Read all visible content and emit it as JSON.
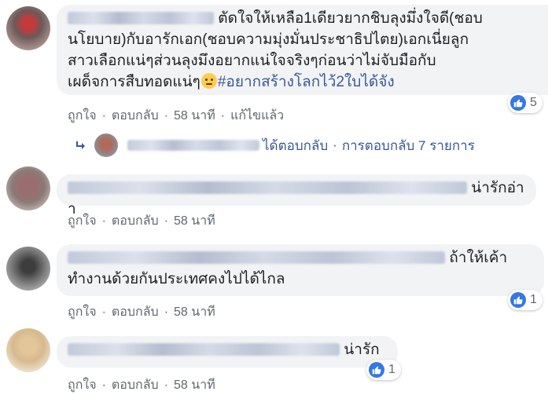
{
  "comments": [
    {
      "text_lines": [
        "ตัดใจให้เหลือ1เดียวยากชิบลุงมึ่งใจดี(ชอบ",
        "นโยบาย)กับอารักเอก(ชอบความมุ่งมั่นประชาธิปไตย)เอกเนี่ยลูก",
        "สาวเลือกแน่ๆส่วนลุงมึงอยากแน่ใจจริงๆก่อนว่าไม่จับมือกับ",
        "เผด็จการสืบทอดแน่ๆ"
      ],
      "hashtag": "#อยากสร้างโลกไว้2ใบได้จัง",
      "like": "ถูกใจ",
      "reply": "ตอบกลับ",
      "time": "58 นาที",
      "edited": "แก้ไขแล้ว",
      "reactions": "5"
    },
    {
      "text": "น่ารักอ่าา",
      "like": "ถูกใจ",
      "reply": "ตอบกลับ",
      "time": "58 นาที"
    },
    {
      "text_lines": [
        "ถ้าให้เค้า",
        "ทำงานด้วยกันประเทศคงไปได้ไกล"
      ],
      "like": "ถูกใจ",
      "reply": "ตอบกลับ",
      "time": "58 นาที",
      "reactions": "1"
    },
    {
      "text": "น่ารัก",
      "like": "ถูกใจ",
      "reply": "ตอบกลับ",
      "time": "58 นาที",
      "reactions": "1"
    }
  ],
  "reply_summary": {
    "replied": "ได้ตอบกลับ",
    "dot": "·",
    "count_text": "การตอบกลับ 7 รายการ"
  },
  "action_separator": "·",
  "icons": {
    "like": "like-thumb-icon",
    "reply_arrow": "reply-arrow-icon",
    "emoji": "thinking-face-emoji"
  },
  "colors": {
    "bubble": "#f2f3f5",
    "link": "#385898",
    "meta": "#606770",
    "like_blue": "#3578e5"
  }
}
